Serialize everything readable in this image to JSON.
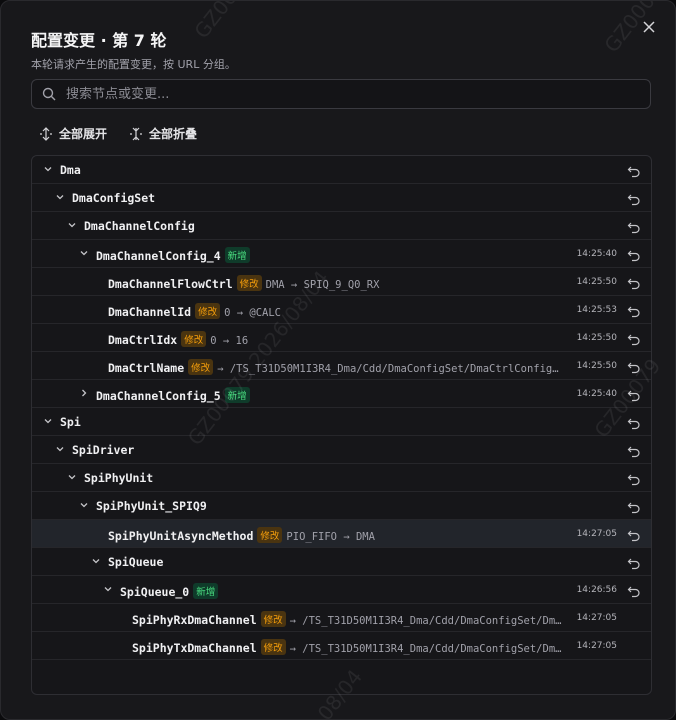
{
  "dialog": {
    "title": "配置变更 · 第 7 轮",
    "subtitle": "本轮请求产生的配置变更，按 URL 分组。",
    "close_icon": "close-icon"
  },
  "search": {
    "placeholder": "搜索节点或变更...",
    "value": ""
  },
  "toolbar": {
    "expand_all": "全部展开",
    "collapse_all": "全部折叠"
  },
  "tree": {
    "rows": [
      {
        "name": "Dma",
        "depth": 0,
        "chevron": "down"
      },
      {
        "name": "DmaConfigSet",
        "depth": 1,
        "chevron": "down"
      },
      {
        "name": "DmaChannelConfig",
        "depth": 2,
        "chevron": "down"
      },
      {
        "name": "DmaChannelConfig_4",
        "depth": 3,
        "chevron": "down",
        "badge": "新增",
        "badge_type": "new",
        "time": "14:25:40"
      },
      {
        "name": "DmaChannelFlowCtrl",
        "depth": 4,
        "badge": "修改",
        "badge_type": "mod",
        "change": "DMA → SPIQ_9_Q0_RX",
        "time": "14:25:50"
      },
      {
        "name": "DmaChannelId",
        "depth": 4,
        "badge": "修改",
        "badge_type": "mod",
        "change": "0 → @CALC",
        "time": "14:25:53"
      },
      {
        "name": "DmaCtrlIdx",
        "depth": 4,
        "badge": "修改",
        "badge_type": "mod",
        "change": "0 → 16",
        "time": "14:25:50"
      },
      {
        "name": "DmaCtrlName",
        "depth": 4,
        "badge": "修改",
        "badge_type": "mod",
        "change": "→ /TS_T31D50M1I3R4_Dma/Cdd/DmaConfigSet/DmaCtrlConfig…",
        "time": "14:25:50"
      },
      {
        "name": "DmaChannelConfig_5",
        "depth": 3,
        "chevron": "right",
        "badge": "新增",
        "badge_type": "new",
        "time": "14:25:40"
      },
      {
        "name": "Spi",
        "depth": 0,
        "chevron": "down"
      },
      {
        "name": "SpiDriver",
        "depth": 1,
        "chevron": "down"
      },
      {
        "name": "SpiPhyUnit",
        "depth": 2,
        "chevron": "down"
      },
      {
        "name": "SpiPhyUnit_SPIQ9",
        "depth": 3,
        "chevron": "down"
      },
      {
        "name": "SpiPhyUnitAsyncMethod",
        "depth": 4,
        "badge": "修改",
        "badge_type": "mod",
        "change": "PIO_FIFO → DMA",
        "time": "14:27:05",
        "highlight": true
      },
      {
        "name": "SpiQueue",
        "depth": 4,
        "chevron": "down"
      },
      {
        "name": "SpiQueue_0",
        "depth": 5,
        "chevron": "down",
        "badge": "新增",
        "badge_type": "new",
        "time": "14:26:56"
      },
      {
        "name": "SpiPhyRxDmaChannel",
        "depth": 6,
        "badge": "修改",
        "badge_type": "mod",
        "change": "→ /TS_T31D50M1I3R4_Dma/Cdd/DmaConfigSet/Dm…",
        "time": "14:27:05",
        "no_undo": true
      },
      {
        "name": "SpiPhyTxDmaChannel",
        "depth": 6,
        "badge": "修改",
        "badge_type": "mod",
        "change": "→ /TS_T31D50M1I3R4_Dma/Cdd/DmaConfigSet/Dm…",
        "time": "14:27:05",
        "no_undo": true
      }
    ]
  },
  "watermark": {
    "texts": [
      "GZ00079 2026/08/04",
      "GZ00079 2026/08/04",
      "GZ00079",
      "GZ00079",
      "08/04"
    ]
  },
  "colors": {
    "accent_new": "#4ade80",
    "accent_mod": "#f59e0b",
    "background": "#18181b"
  }
}
